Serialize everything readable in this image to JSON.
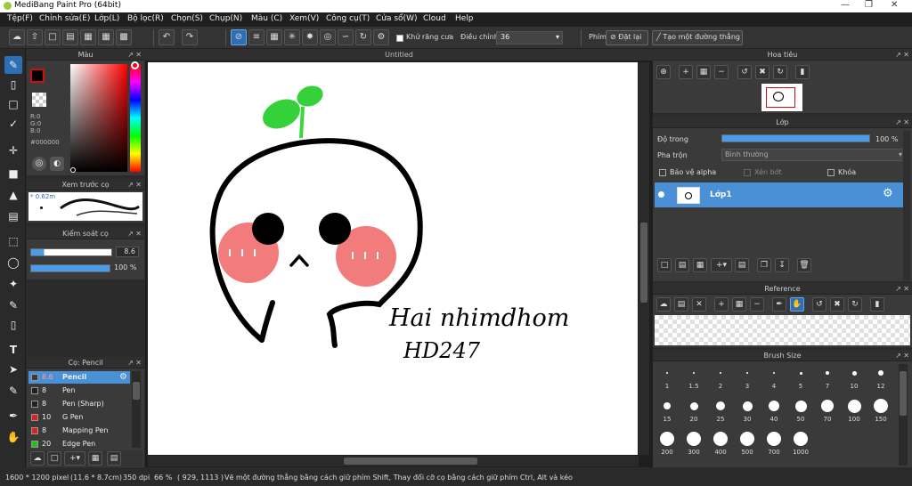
{
  "app": {
    "title": "MediBang Paint Pro (64bit)"
  },
  "menu": [
    "Tệp(F)",
    "Chỉnh sửa(E)",
    "Lớp(L)",
    "Bộ lọc(R)",
    "Chọn(S)",
    "Chụp(N)",
    "Màu (C)",
    "Xem(V)",
    "Công cụ(T)",
    "Cửa sổ(W)",
    "Cloud",
    "Help"
  ],
  "toolbar": {
    "antialias_label": "Khử răng cưa",
    "correction_label": "Điều chỉnh",
    "correction_value": "36",
    "pen_label": "Phím",
    "reset_label": "Đặt lại",
    "create_line_label": "Tạo một đường thẳng"
  },
  "color_panel": {
    "title": "Màu",
    "r": "R:0",
    "g": "G:0",
    "b": "B:0",
    "hex": "#000000",
    "fg_color": "#000000",
    "hue_color": "#ff0000"
  },
  "preview_panel": {
    "title": "Xem trước cọ",
    "size": "* 0.62m"
  },
  "brush_control": {
    "title": "Kiểm soát cọ",
    "size_value": "8.6",
    "opacity_value": "100 %",
    "opacity_fraction": 1.0
  },
  "brush_list": {
    "title": "Cọ: Pencil",
    "items": [
      {
        "size": "8.6",
        "name": "Pencil",
        "color": "#3a3a3a",
        "selected": true
      },
      {
        "size": "8",
        "name": "Pen",
        "color": "#222222"
      },
      {
        "size": "8",
        "name": "Pen (Sharp)",
        "color": "#222222"
      },
      {
        "size": "10",
        "name": "G Pen",
        "color": "#e02020"
      },
      {
        "size": "8",
        "name": "Mapping Pen",
        "color": "#e02020"
      },
      {
        "size": "20",
        "name": "Edge Pen",
        "color": "#20c020"
      }
    ]
  },
  "canvas": {
    "title": "Untitled",
    "text_line1": "Hai nhimdhom",
    "text_line2": "HD247"
  },
  "status": {
    "size": "1600 * 1200 pixel",
    "cm": "(11.6 * 8.7cm)",
    "dpi": "350 dpi",
    "zoom": "66 %",
    "coords": "( 929, 1113 )",
    "hint": "Vẽ một đường thẳng bằng cách giữ phím Shift, Thay đổi cỡ cọ bằng cách giữ phím Ctrl, Alt và kéo"
  },
  "navigator": {
    "title": "Hoa tiêu"
  },
  "layer_panel": {
    "title": "Lớp",
    "opacity_label": "Độ trong",
    "opacity_value": "100 %",
    "opacity_fraction": 1.0,
    "blend_label": "Pha trộn",
    "blend_value": "Bình thường",
    "protect_alpha": "Bảo vệ alpha",
    "clipping": "Xén bớt",
    "lock": "Khóa",
    "layer_name": "Lớp1"
  },
  "reference_panel": {
    "title": "Reference"
  },
  "brush_size_panel": {
    "title": "Brush Size",
    "sizes": [
      "1",
      "1.5",
      "2",
      "3",
      "4",
      "5",
      "7",
      "10",
      "12",
      "15",
      "20",
      "25",
      "30",
      "40",
      "50",
      "70",
      "100",
      "150",
      "200",
      "300",
      "400",
      "500",
      "700",
      "1000"
    ]
  }
}
